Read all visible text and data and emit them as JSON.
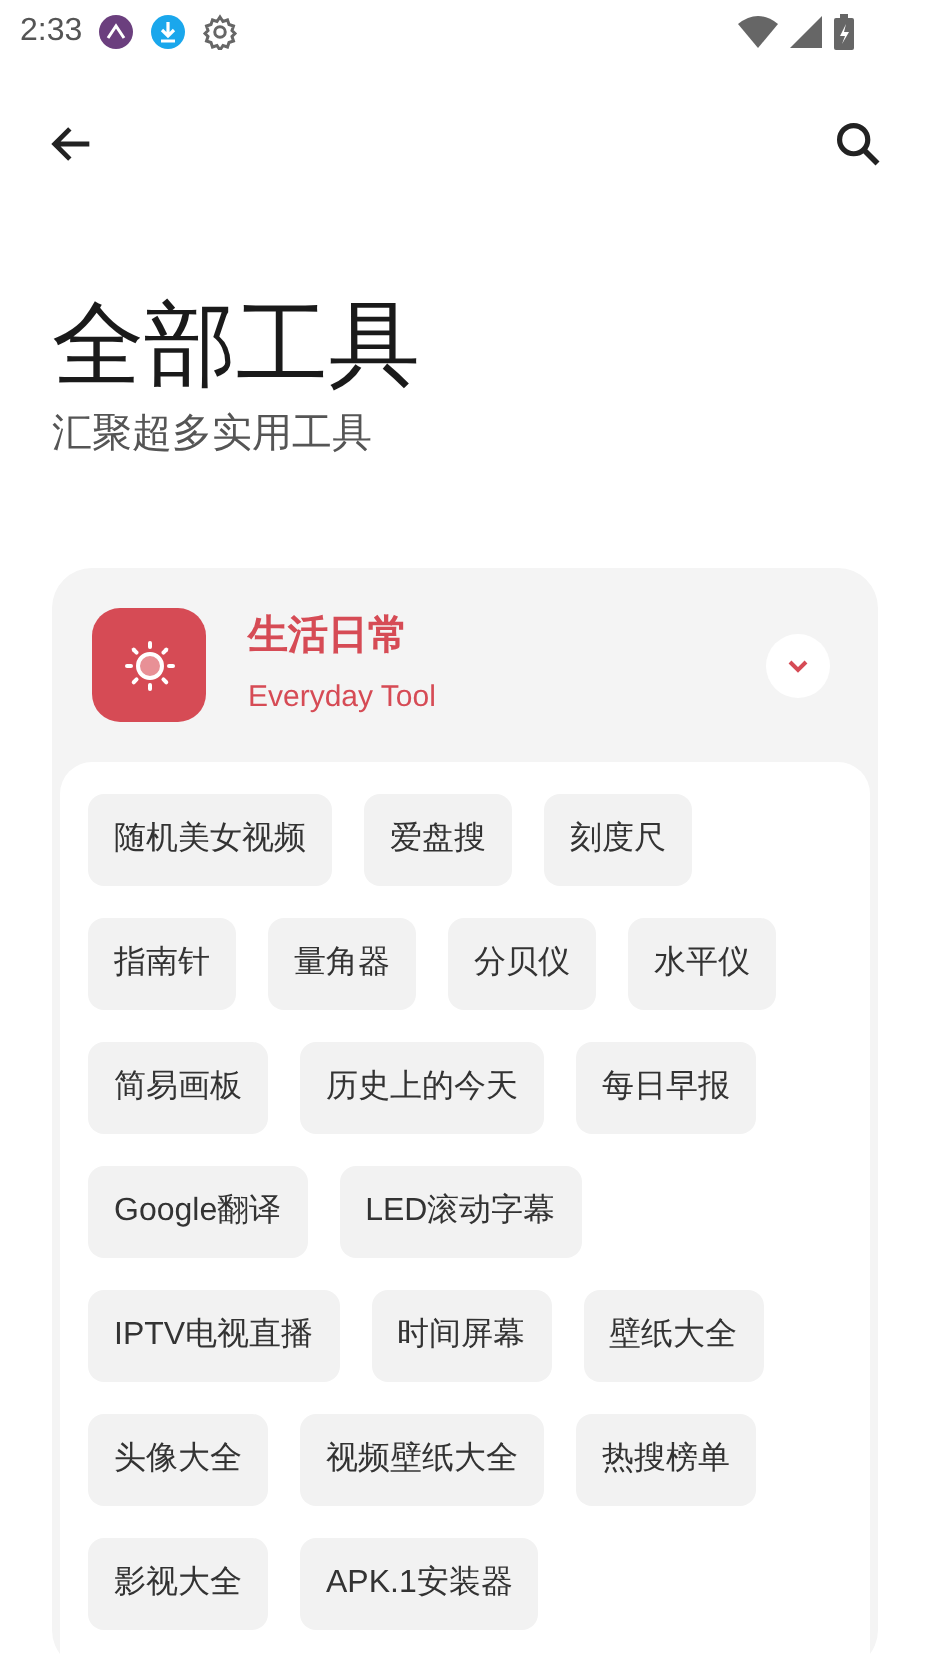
{
  "status_bar": {
    "time": "2:33"
  },
  "page": {
    "title": "全部工具",
    "subtitle": "汇聚超多实用工具"
  },
  "categories": [
    {
      "title": "生活日常",
      "subtitle": "Everyday Tool",
      "color": "#d64b55",
      "expanded": true,
      "tools": [
        "随机美女视频",
        "爱盘搜",
        "刻度尺",
        "指南针",
        "量角器",
        "分贝仪",
        "水平仪",
        "简易画板",
        "历史上的今天",
        "每日早报",
        "Google翻译",
        "LED滚动字幕",
        "IPTV电视直播",
        "时间屏幕",
        "壁纸大全",
        "头像大全",
        "视频壁纸大全",
        "热搜榜单",
        "影视大全",
        "APK.1安装器"
      ]
    }
  ]
}
